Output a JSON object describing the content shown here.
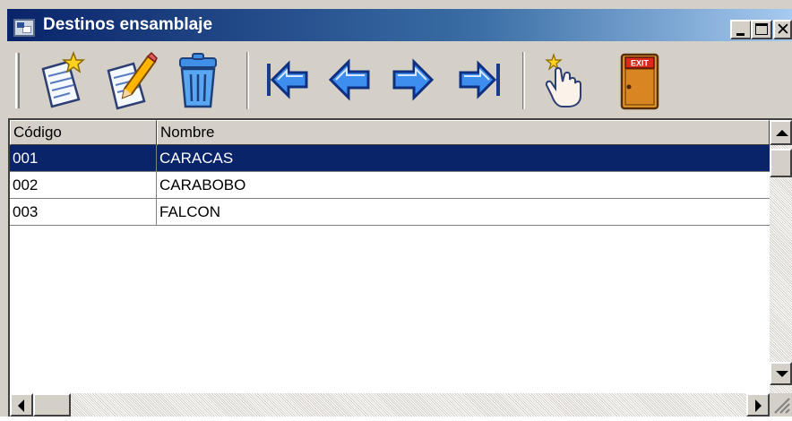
{
  "window": {
    "title": "Destinos ensamblaje",
    "buttons": [
      "minimize",
      "maximize",
      "close"
    ]
  },
  "toolbar": {
    "items": [
      {
        "name": "new-record",
        "icon": "new-document-star-icon"
      },
      {
        "name": "edit-record",
        "icon": "edit-document-pencil-icon"
      },
      {
        "name": "delete-record",
        "icon": "trash-can-icon"
      },
      {
        "name": "first-record",
        "icon": "first-arrow-icon"
      },
      {
        "name": "previous-record",
        "icon": "previous-arrow-icon"
      },
      {
        "name": "next-record",
        "icon": "next-arrow-icon"
      },
      {
        "name": "last-record",
        "icon": "last-arrow-icon"
      },
      {
        "name": "select-record",
        "icon": "pointing-hand-icon"
      },
      {
        "name": "exit",
        "icon": "exit-door-icon",
        "label": "EXIT"
      }
    ]
  },
  "grid": {
    "columns": [
      "Código",
      "Nombre"
    ],
    "rows": [
      {
        "codigo": "001",
        "nombre": "CARACAS",
        "selected": true
      },
      {
        "codigo": "002",
        "nombre": "CARABOBO",
        "selected": false
      },
      {
        "codigo": "003",
        "nombre": "FALCON",
        "selected": false
      }
    ]
  },
  "colors": {
    "selection": "#0a246a",
    "titlebar_start": "#0a246a",
    "titlebar_end": "#a6caf0",
    "face": "#d4d0c8",
    "arrow_blue": "#1a5fd0"
  }
}
